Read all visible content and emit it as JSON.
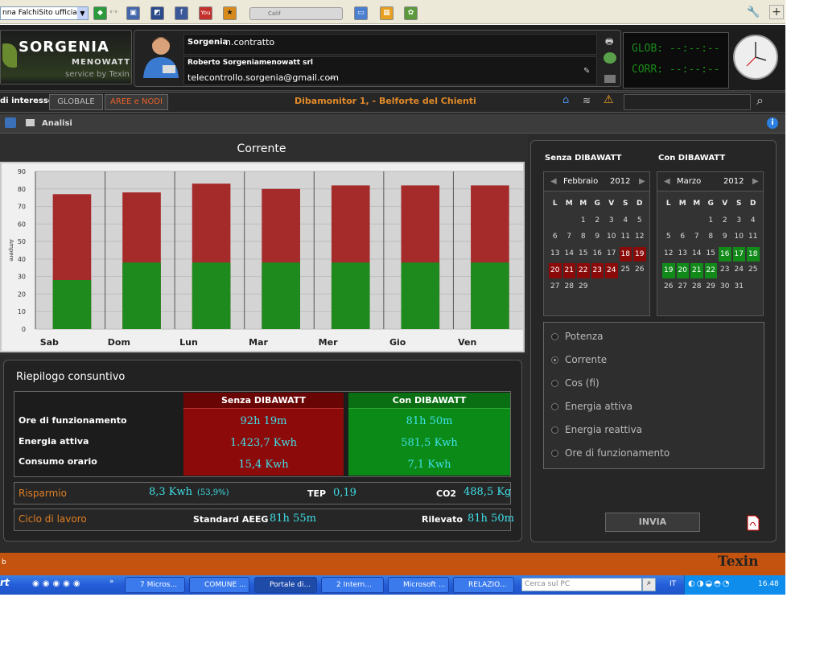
{
  "browser": {
    "address_text": "nna FalchiSito ufficiale de",
    "media_label": "Calif",
    "icons": [
      "green-arrow-icon",
      "double-arrow-icon",
      "save-icon",
      "delicious-icon",
      "facebook-icon",
      "youtube-icon",
      "star-icon",
      "media-player-icon",
      "screen-icon",
      "calculator-icon",
      "map-icon",
      "wrench-icon",
      "plus-icon"
    ]
  },
  "header": {
    "logo_main": "SORGENIA",
    "logo_sub": "MENOWATT",
    "logo_service": "service by Texin",
    "user_label": "Sorgenia",
    "contract_label": "n.contratto",
    "company": "Roberto Sorgeniamenowatt srl",
    "email": "telecontrollo.sorgenia@gmail.com",
    "email_suffix": "--",
    "glob_label": "GLOB:",
    "glob_value": "--:--:--",
    "corr_label": "CORR:",
    "corr_value": "--:--:--"
  },
  "subbar": {
    "interessi_label": "di interesse:",
    "tab_globale": "GLOBALE",
    "tab_aree": "AREE e NODI",
    "device": "Dibamonitor 1,  - Belforte del Chienti",
    "search_value": ""
  },
  "section": {
    "title": "Analisi"
  },
  "chart_data": {
    "type": "bar",
    "title": "Corrente",
    "ylabel": "Ampere",
    "xlabel": "",
    "ylim": [
      0,
      90
    ],
    "yticks": [
      0,
      10,
      20,
      30,
      40,
      50,
      60,
      70,
      80,
      90
    ],
    "categories": [
      "Sab",
      "Dom",
      "Lun",
      "Mar",
      "Mer",
      "Gio",
      "Ven"
    ],
    "series": [
      {
        "name": "Senza DIBAWATT",
        "color": "#a52a2a",
        "values": [
          77,
          78,
          83,
          80,
          82,
          82,
          82
        ]
      },
      {
        "name": "Con DIBAWATT",
        "color": "#1e8a1e",
        "values": [
          28,
          38,
          38,
          38,
          38,
          38,
          38
        ]
      }
    ],
    "grid": true
  },
  "riepilogo": {
    "title": "Riepilogo consuntivo",
    "rows": [
      "Ore di funzionamento",
      "Energia attiva",
      "Consumo orario"
    ],
    "senza": {
      "header": "Senza DIBAWATT",
      "values": [
        "92h 19m",
        "1.423,7 Kwh",
        "15,4 Kwh"
      ],
      "color": "#8d0a0a"
    },
    "con": {
      "header": "Con DIBAWATT",
      "values": [
        "81h 50m",
        "581,5 Kwh",
        "7,1 Kwh"
      ],
      "color": "#0c8a18"
    },
    "risparmio_label": "Risparmio",
    "risparmio_value": "8,3 Kwh",
    "risparmio_pct": "(53,9%)",
    "tep_label": "TEP",
    "tep_value": "0,19",
    "co2_label": "CO2",
    "co2_value": "488,5 Kg",
    "ciclo_label": "Ciclo di lavoro",
    "standard_label": "Standard AEEG",
    "standard_value": "81h 55m",
    "rilevato_label": "Rilevato",
    "rilevato_value": "81h 50m"
  },
  "calendars": {
    "left": {
      "label": "Senza DIBAWATT",
      "month": "Febbraio",
      "year": "2012",
      "days_header": [
        "L",
        "M",
        "M",
        "G",
        "V",
        "S",
        "D"
      ],
      "start_offset": 2,
      "days": 29,
      "highlight": [
        18,
        19,
        20,
        21,
        22,
        23,
        24
      ],
      "highlight_class": "r"
    },
    "right": {
      "label": "Con DIBAWATT",
      "month": "Marzo",
      "year": "2012",
      "days_header": [
        "L",
        "M",
        "M",
        "G",
        "V",
        "S",
        "D"
      ],
      "start_offset": 3,
      "days": 31,
      "highlight": [
        16,
        17,
        18,
        19,
        20,
        21,
        22
      ],
      "highlight_class": "g"
    }
  },
  "options": {
    "items": [
      "Potenza",
      "Corrente",
      "Cos (fi)",
      "Energia attiva",
      "Energia reattiva",
      "Ore di funzionamento"
    ],
    "selected": "Corrente"
  },
  "invia_label": "INVIA",
  "footer": {
    "left_text": "b",
    "brand": "Texin"
  },
  "taskbar": {
    "start": "rt",
    "tasks": [
      "7 Micros...",
      "COMUNE ...",
      "Portale di...",
      "2 Intern...",
      "Microsoft ...",
      "RELAZIO..."
    ],
    "search_placeholder": "Cerca sul PC",
    "lang": "IT",
    "time": "16.48"
  }
}
